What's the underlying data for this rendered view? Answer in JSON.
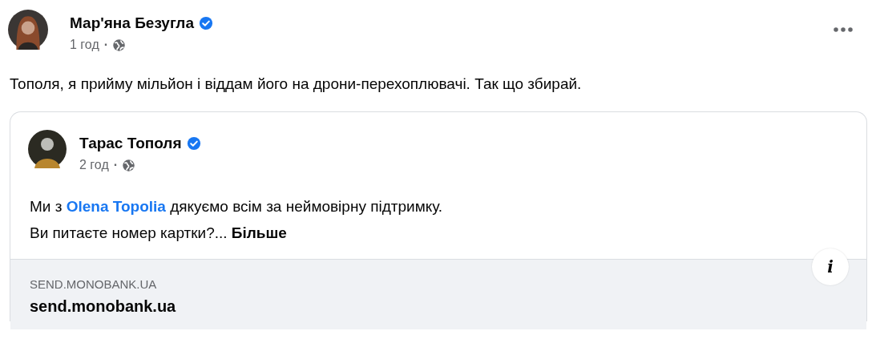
{
  "post": {
    "author": {
      "name": "Мар'яна Безугла",
      "verified": true
    },
    "time": "1 год",
    "separator": "·",
    "menu": true,
    "text": "Тополя, я прийму мільйон і віддам його на дрони-перехоплювачі. Так що збирай.",
    "shared_post": {
      "author": {
        "name": "Тарас Тополя",
        "verified": true
      },
      "time": "2 год",
      "separator": "·",
      "lines": [
        [
          {
            "kind": "text",
            "text": "Ми з "
          },
          {
            "kind": "mention",
            "text": "Olena Topolia"
          },
          {
            "kind": "text",
            "text": " дякуємо всім за неймовірну підтримку."
          }
        ],
        [
          {
            "kind": "text",
            "text": "Ви питаєте номер картки?... "
          },
          {
            "kind": "more",
            "text": "Більше"
          }
        ]
      ],
      "link_preview": {
        "domain": "SEND.MONOBANK.UA",
        "title": "send.monobank.ua",
        "info_label": "i"
      }
    }
  }
}
